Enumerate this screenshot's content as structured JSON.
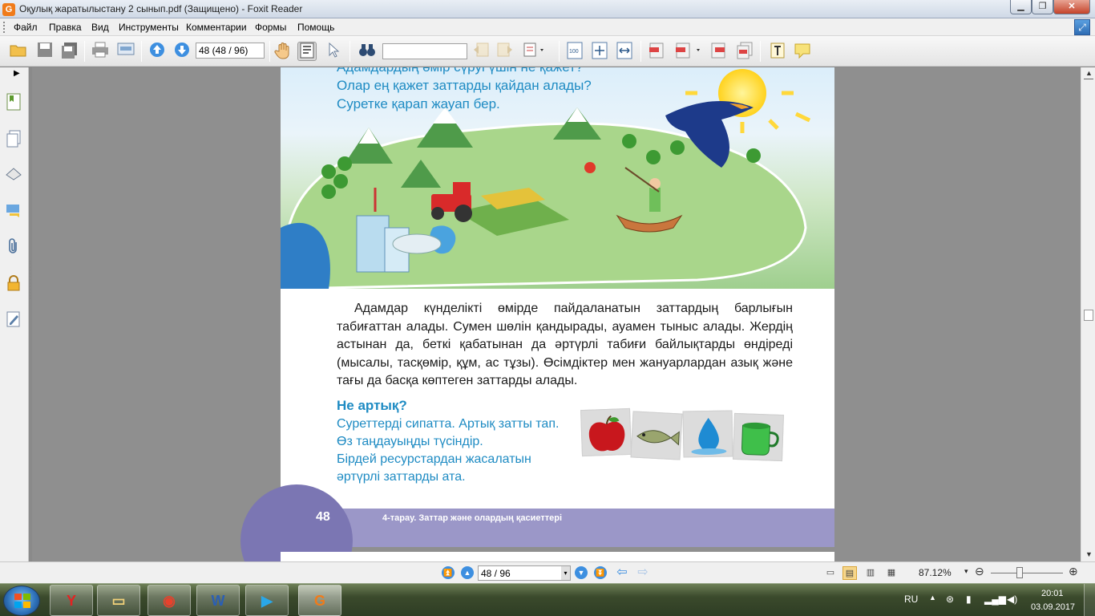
{
  "window": {
    "app_icon_glyph": "G",
    "title": "Оқулық жаратылыстану 2 сынып.pdf (Защищено) - Foxit Reader",
    "min_glyph": "▁",
    "max_glyph": "❐",
    "close_glyph": "✕",
    "restore_glyph": "⤢"
  },
  "menu": {
    "items": [
      "Файл",
      "Правка",
      "Вид",
      "Инструменты",
      "Комментарии",
      "Формы",
      "Помощь"
    ]
  },
  "toolbar": {
    "page_field_value": "48 (48 / 96)",
    "find_field_value": "",
    "icons": [
      "open-folder",
      "save",
      "save-all",
      "print",
      "scan",
      "page-up",
      "page-down",
      "hand-tool",
      "text-select",
      "select-pointer",
      "find-binoculars",
      "prev-result",
      "next-result",
      "find-options",
      "actual-size",
      "fit-page",
      "fit-width",
      "pdf-create",
      "pdf-convert",
      "pdf-export",
      "pdf-combine",
      "typewriter",
      "note"
    ]
  },
  "sidebar": {
    "collapse_glyph": "▶",
    "icons": [
      "bookmarks-icon",
      "pages-icon",
      "layers-icon",
      "comments-icon",
      "attachments-icon",
      "security-icon",
      "signatures-icon"
    ]
  },
  "document": {
    "questions": [
      "Адамдардың өмір сүруі үшін не қажет?",
      "Олар ең қажет заттарды қайдан алады?",
      "Суретке қарап жауап бер."
    ],
    "body_text": "Адамдар күнделікті өмірде пайдаланатын заттардың барлығын табиғаттан алады. Сумен шөлін қандырады, ауамен тыныс алады. Жердің астынан да, беткі қабатынан да әртүрлі табиғи байлықтарды өндіреді (мысалы, тасқөмір, құм, ас тұзы). Өсімдіктер мен жануарлардан азық және тағы да басқа көптеген заттарды алады.",
    "section_title": "Не артық?",
    "task_lines": [
      "Суреттерді сипатта. Артық затты тап.",
      "Өз таңдауыңды түсіндір.",
      "Бірдей ресурстардан жасалатын",
      "әртүрлі заттарды ата."
    ],
    "picture_cards": [
      "apple-icon",
      "fish-icon",
      "water-drop-icon",
      "cup-icon"
    ],
    "page_number": "48",
    "footer_caption": "4-тарау. Заттар және олардың қасиеттері"
  },
  "statusbar": {
    "nav_value": "48 / 96",
    "zoom": "87.12%",
    "drop_glyph": "▾",
    "minus_glyph": "⊖",
    "plus_glyph": "⊕"
  },
  "taskbar": {
    "apps": [
      "yandex-browser",
      "file-explorer",
      "google-chrome",
      "microsoft-word",
      "media-player",
      "foxit-reader"
    ],
    "app_glyphs": [
      "Y",
      "▭",
      "◉",
      "W",
      "▶",
      "G"
    ],
    "tray": {
      "language": "RU",
      "up_glyph": "▲",
      "time": "20:01",
      "date": "03.09.2017"
    }
  },
  "colors": {
    "accent_blue": "#1e8bc3",
    "footer_purple": "#9b97c8",
    "foxit_orange": "#f07b1a"
  }
}
